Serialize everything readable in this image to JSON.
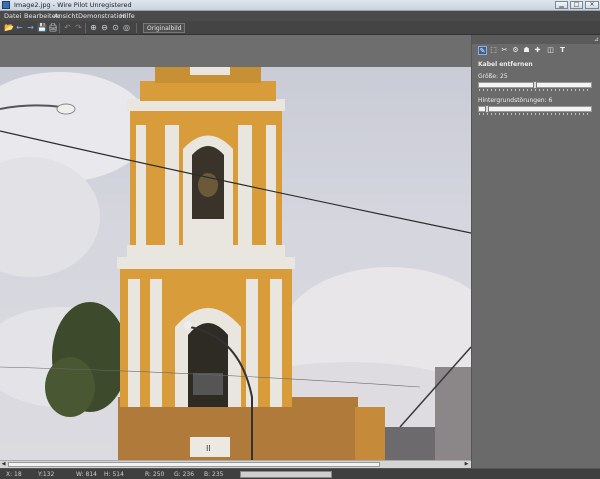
{
  "window": {
    "title": "Image2.jpg - Wire Pilot Unregistered",
    "min_glyph": "▁",
    "max_glyph": "□",
    "close_glyph": "✕"
  },
  "menu": [
    "Datei",
    "Bearbeiten",
    "Ansicht",
    "Demonstration",
    "Hilfe"
  ],
  "toolbar": {
    "icons": {
      "open": "📂",
      "back": "←",
      "forward": "→",
      "save": "💾",
      "print": "🖨",
      "undo": "↶",
      "redo": "↷",
      "zoom_in": "⊕",
      "zoom_out": "⊖",
      "zoom_fit": "⊙",
      "zoom_actual": "◎"
    },
    "original_label": "Originalbild"
  },
  "panel": {
    "pin_glyph": "⊿",
    "tools": [
      "✎",
      "⬚",
      "✂",
      "⚙",
      "☗",
      "✚",
      "◫",
      "T"
    ],
    "title": "Kabel entfernen",
    "size_label": "Größe: 25",
    "size_value": 25,
    "size_max": 100,
    "bg_label": "Hintergrundstörungen: 6",
    "bg_value": 6,
    "bg_max": 100
  },
  "scrollbar": {
    "left_arrow": "◀",
    "right_arrow": "▶"
  },
  "status": {
    "x": "X: 18",
    "y": "Y:132",
    "w": "W: 814",
    "h": "H: 514",
    "r": "R: 250",
    "g": "G: 236",
    "b": "B: 235"
  },
  "colors": {
    "accent": "#3a5f92",
    "sky": "#d3d4dc",
    "tower_yellow": "#d99c3a",
    "tower_white": "#e9e6df"
  }
}
